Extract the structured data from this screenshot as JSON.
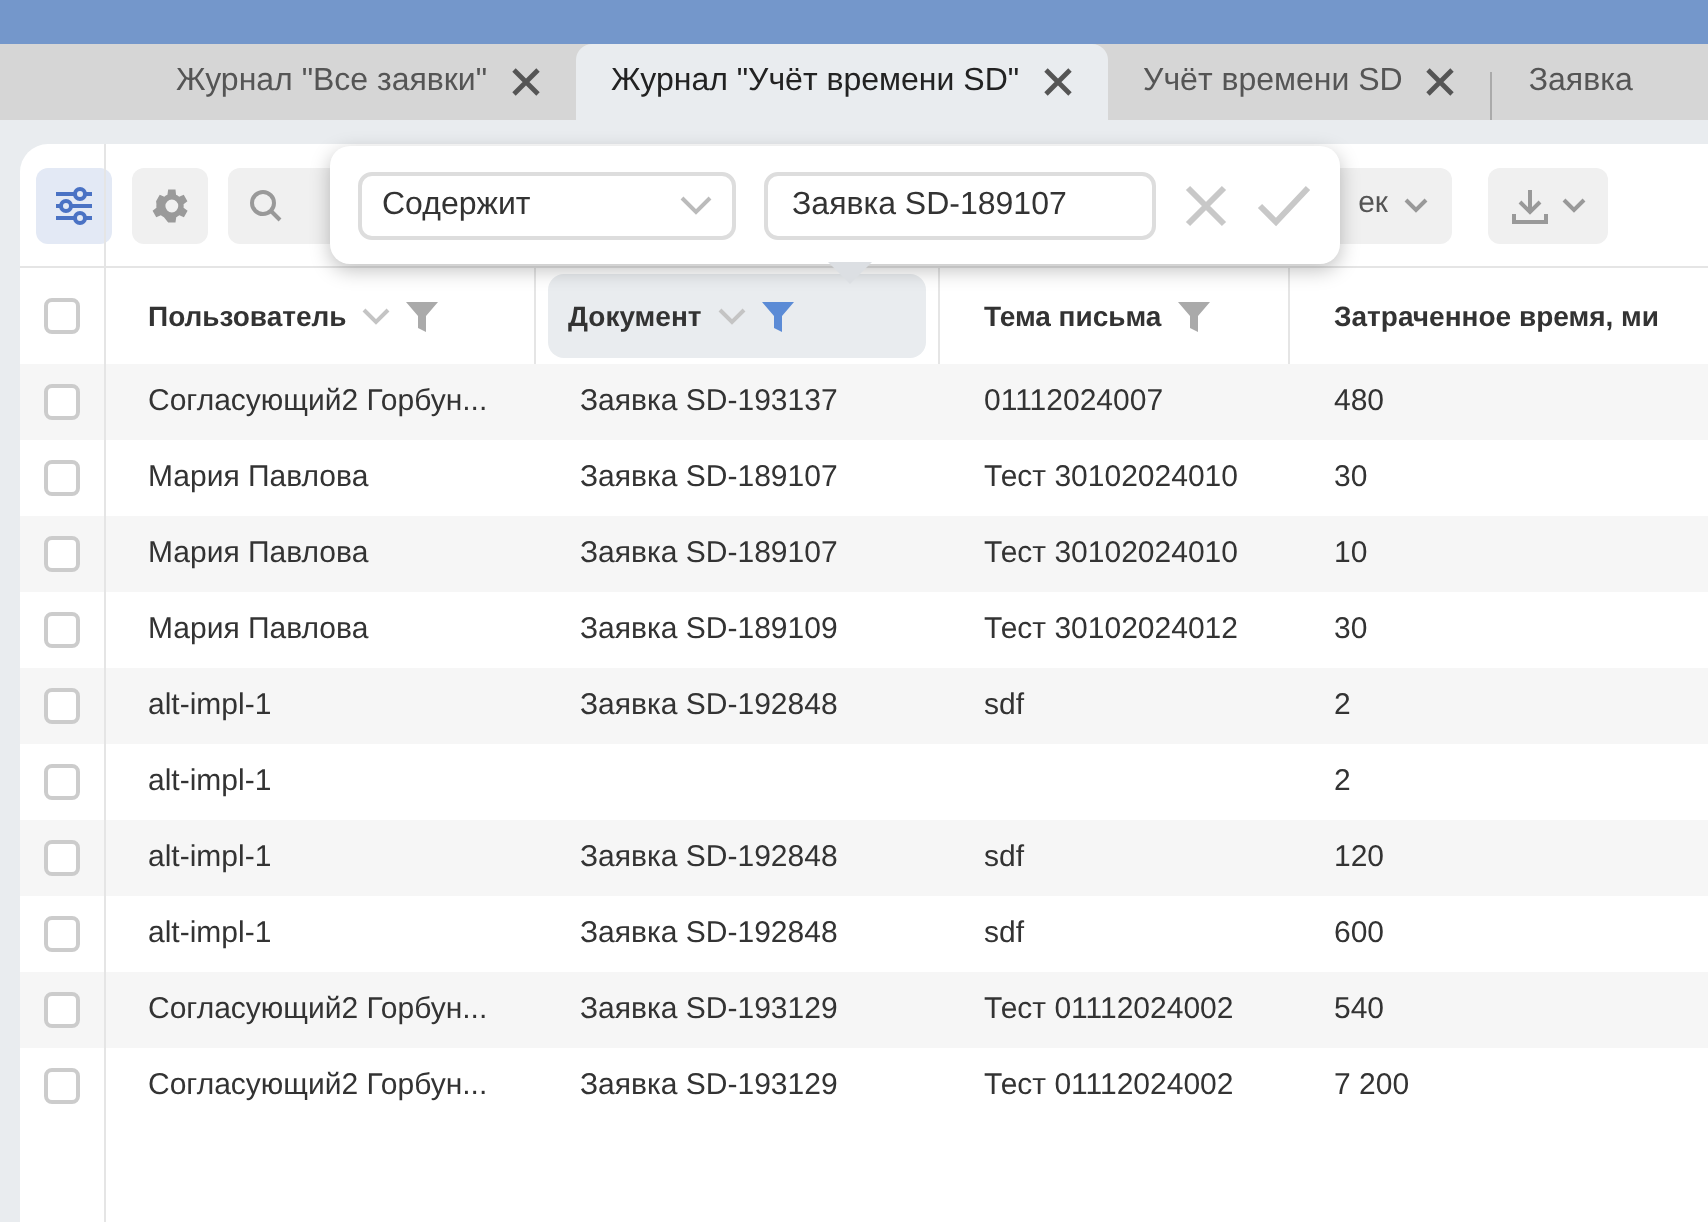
{
  "tabs": [
    {
      "label": "Журнал \"Все заявки\"",
      "selected": false,
      "closable": true
    },
    {
      "label": "Журнал \"Учёт времени SD\"",
      "selected": true,
      "closable": true
    },
    {
      "label": "Учёт времени SD",
      "selected": false,
      "closable": true
    },
    {
      "label": "Заявка",
      "selected": false,
      "closable": false
    }
  ],
  "toolbar": {
    "columns_button_active": true,
    "view_dropdown_text": "ек"
  },
  "filter_popup": {
    "operator": "Содержит",
    "value": "Заявка SD-189107"
  },
  "table": {
    "all_checked": false,
    "columns": [
      {
        "label": "Пользователь",
        "sortable": true,
        "filterable": true,
        "filtered": false
      },
      {
        "label": "Документ",
        "sortable": true,
        "filterable": true,
        "filtered": true
      },
      {
        "label": "Тема письма",
        "sortable": false,
        "filterable": true,
        "filtered": false
      },
      {
        "label": "Затраченное время, ми",
        "sortable": false,
        "filterable": false,
        "filtered": false
      }
    ],
    "rows": [
      {
        "checked": false,
        "cells": [
          "Согласующий2 Горбун...",
          "Заявка SD-193137",
          "01112024007",
          "480"
        ]
      },
      {
        "checked": false,
        "cells": [
          "Мария Павлова",
          "Заявка SD-189107",
          "Тест 30102024010",
          "30"
        ]
      },
      {
        "checked": false,
        "cells": [
          "Мария Павлова",
          "Заявка SD-189107",
          "Тест 30102024010",
          "10"
        ]
      },
      {
        "checked": false,
        "cells": [
          "Мария Павлова",
          "Заявка SD-189109",
          "Тест 30102024012",
          "30"
        ]
      },
      {
        "checked": false,
        "cells": [
          "alt-impl-1",
          "Заявка SD-192848",
          "sdf",
          "2"
        ]
      },
      {
        "checked": false,
        "cells": [
          "alt-impl-1",
          null,
          null,
          "2"
        ]
      },
      {
        "checked": false,
        "cells": [
          "alt-impl-1",
          "Заявка SD-192848",
          "sdf",
          "120"
        ]
      },
      {
        "checked": false,
        "cells": [
          "alt-impl-1",
          "Заявка SD-192848",
          "sdf",
          "600"
        ]
      },
      {
        "checked": false,
        "cells": [
          "Согласующий2 Горбун...",
          "Заявка SD-193129",
          "Тест 01112024002",
          "540"
        ]
      },
      {
        "checked": false,
        "cells": [
          "Согласующий2 Горбун...",
          "Заявка SD-193129",
          "Тест 01112024002",
          "7 200"
        ]
      }
    ]
  }
}
